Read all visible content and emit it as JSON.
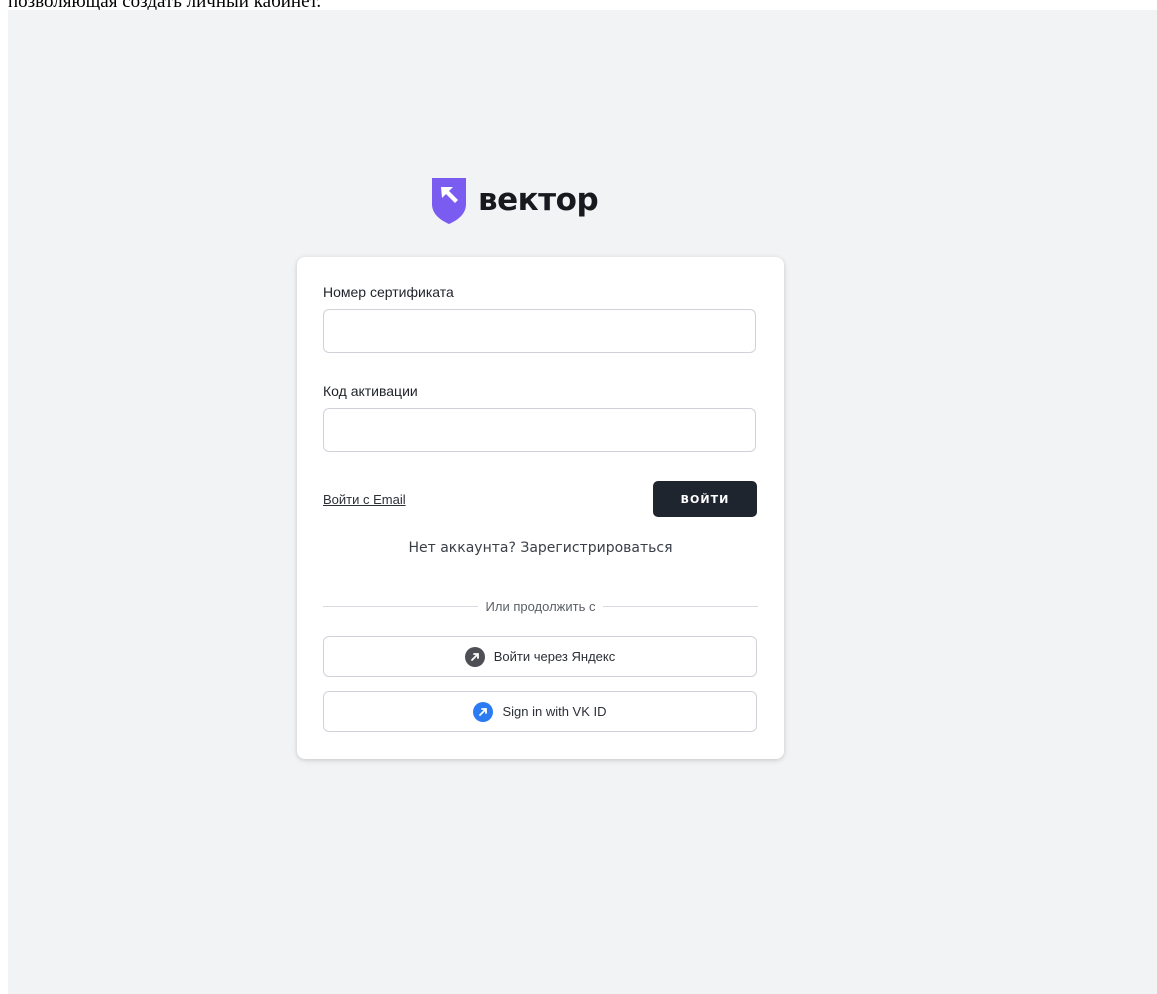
{
  "caption": "позволяющая создать личный кабинет.",
  "logo": {
    "text": "вектор",
    "mark_color": "#7b5cf0"
  },
  "form": {
    "certificate_label": "Номер сертификата",
    "certificate_value": "",
    "activation_label": "Код активации",
    "activation_value": "",
    "email_link": "Войти с Email",
    "login_button": "ВОЙТИ",
    "register_text": "Нет аккаунта? Зарегистрироваться",
    "divider_text": "Или продолжить с"
  },
  "oauth": {
    "yandex": {
      "label": "Войти через Яндекс",
      "icon": "yandex-icon",
      "icon_color": "#4d4f55"
    },
    "vk": {
      "label": "Sign in with VK ID",
      "icon": "vk-id-icon",
      "icon_color": "#2c7bf2"
    }
  },
  "colors": {
    "page_background": "#f2f3f5",
    "card_background": "#ffffff",
    "button_background": "#1e252f"
  }
}
